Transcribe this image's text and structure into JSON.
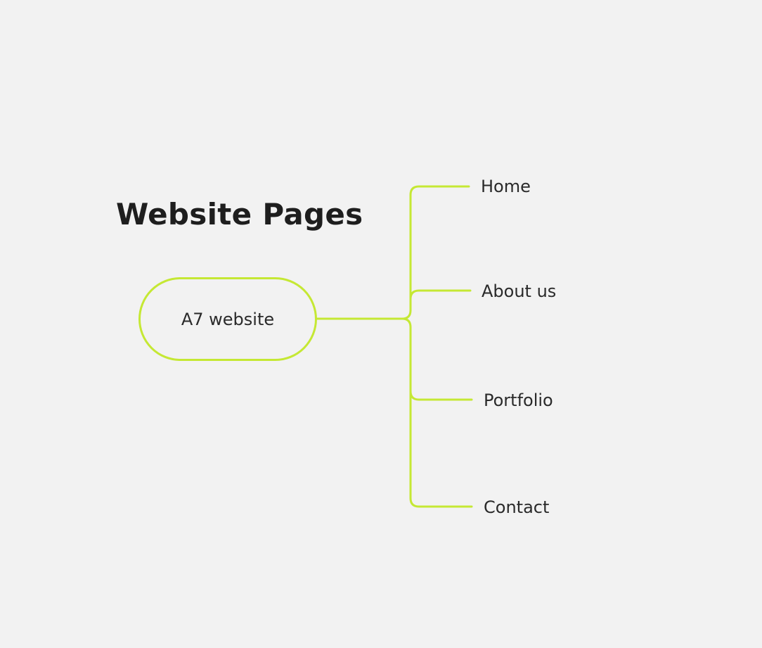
{
  "title": "Website Pages",
  "root": {
    "label": "A7 website"
  },
  "children": [
    {
      "label": "Home"
    },
    {
      "label": "About us"
    },
    {
      "label": "Portfolio"
    },
    {
      "label": "Contact"
    }
  ],
  "colors": {
    "background": "#f2f2f2",
    "connector": "#c5e834",
    "text": "#222222"
  }
}
